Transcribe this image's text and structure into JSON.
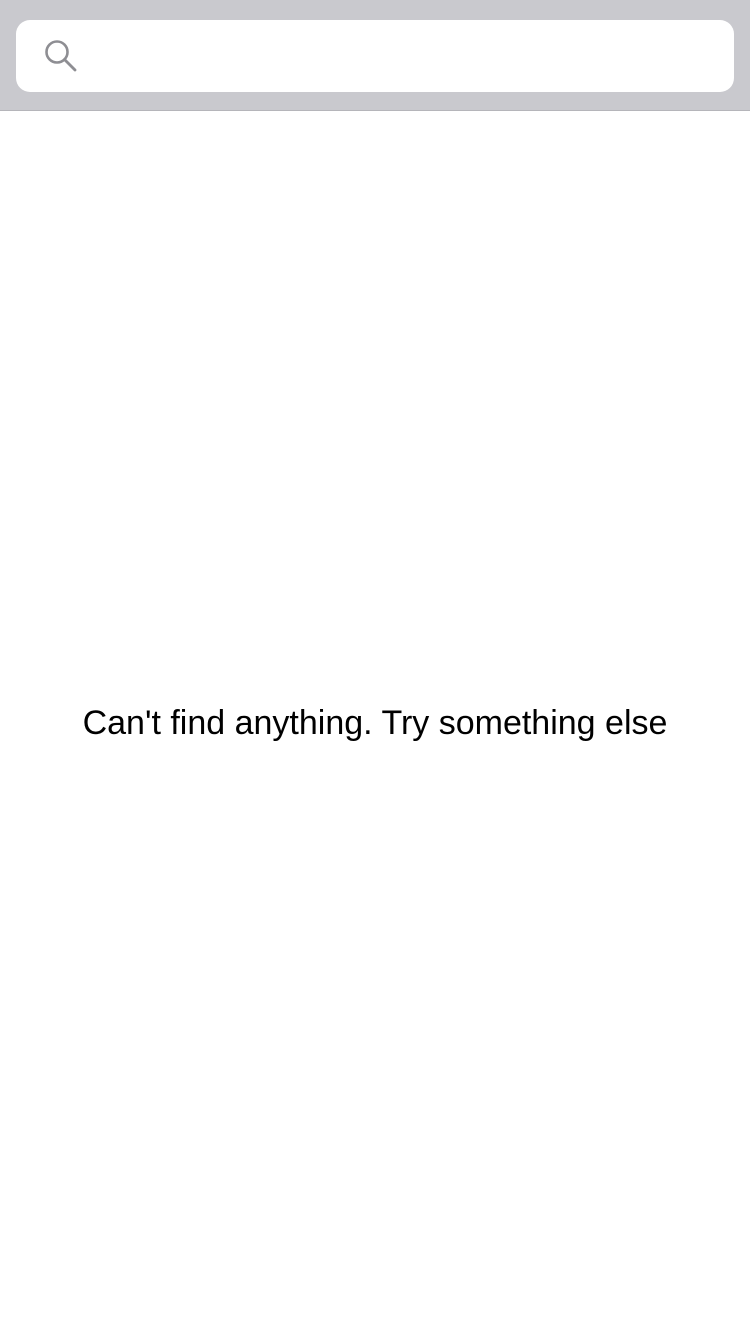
{
  "search": {
    "value": "",
    "placeholder": "",
    "icon": "search-icon"
  },
  "empty_state": {
    "message": "Can't find anything. Try something else"
  },
  "colors": {
    "search_bar_background": "#c9c9ce",
    "search_field_background": "#ffffff",
    "icon": "#8e8e93",
    "text": "#000000"
  }
}
